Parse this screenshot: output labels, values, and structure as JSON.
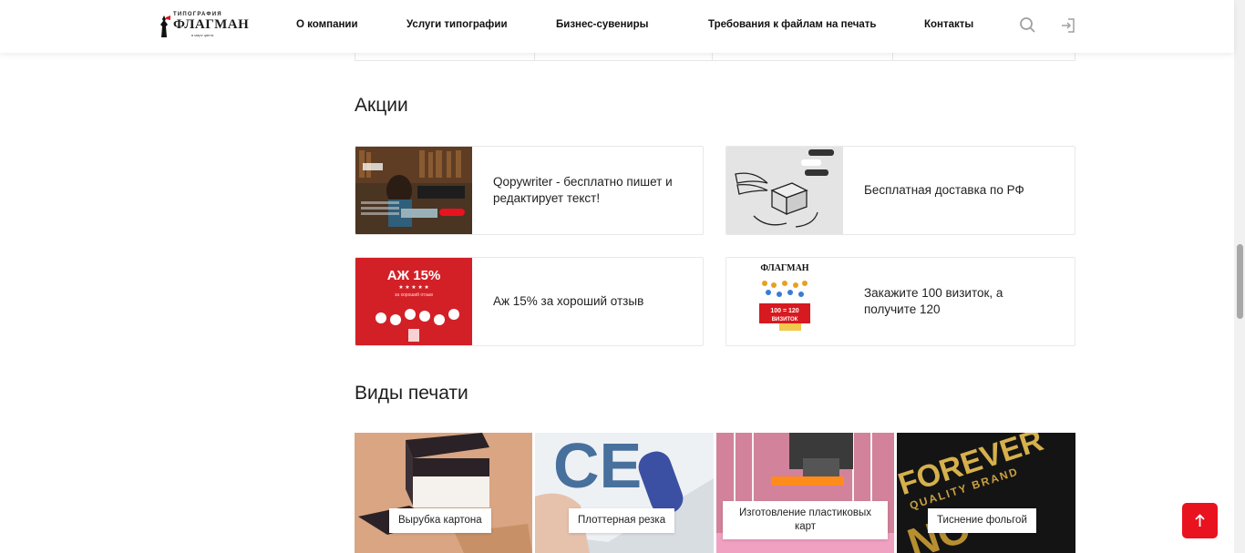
{
  "header": {
    "logo": {
      "top": "ТИПОГРАФИЯ",
      "main": "ФЛАГМАН",
      "bottom": "в мире цвета"
    },
    "nav": [
      {
        "label": "О компании"
      },
      {
        "label": "Услуги типографии"
      },
      {
        "label": "Бизнес-сувениры"
      },
      {
        "label": "Требования к файлам на печать"
      },
      {
        "label": "Контакты"
      }
    ],
    "icons": [
      "search-icon",
      "login-icon"
    ]
  },
  "promotions": {
    "title": "Акции",
    "items": [
      {
        "text": "Qopywriter - бесплатно пишет и редактирует текст!",
        "image": "copywriter-promo-image"
      },
      {
        "text": "Бесплатная доставка по РФ",
        "image": "delivery-promo-image"
      },
      {
        "text": "Аж 15% за хороший отзыв",
        "image": "review-discount-image",
        "image_title": "АЖ 15%",
        "image_subtitle": "за хороший отзыв"
      },
      {
        "text": "Закажите 100 визиток, а получите 120",
        "image": "business-cards-promo-image",
        "image_badge": "100 = 120",
        "image_badge_sub": "ВИЗИТОК"
      }
    ]
  },
  "print_types": {
    "title": "Виды печати",
    "items": [
      {
        "label": "Вырубка картона"
      },
      {
        "label": "Плоттерная резка"
      },
      {
        "label": "Изготовление пластиковых карт"
      },
      {
        "label": "Тиснение фольгой"
      }
    ]
  },
  "colors": {
    "accent": "#e8131f",
    "text": "#1d1d1f",
    "border": "#e8e8e8"
  }
}
